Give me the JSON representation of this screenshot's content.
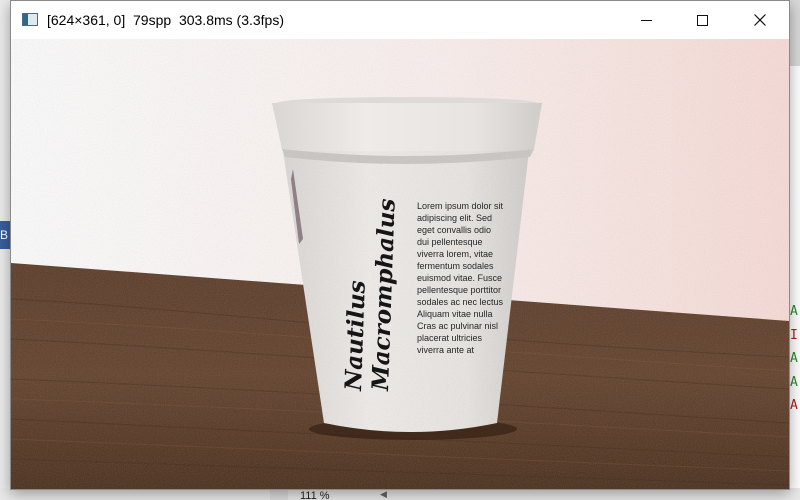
{
  "background": {
    "left_tab_text": "B",
    "right_letters": [
      {
        "char": "A",
        "color": "#2a8a2a"
      },
      {
        "char": "I",
        "color": "#b02020"
      },
      {
        "char": "A",
        "color": "#2a8a2a"
      },
      {
        "char": "A",
        "color": "#2a8a2a"
      },
      {
        "char": "A",
        "color": "#b02020"
      }
    ],
    "zoom_text": "111 %"
  },
  "window": {
    "title": "[624×361, 0]  79spp  303.8ms (3.3fps)",
    "minimize_icon": "minimize-icon",
    "maximize_icon": "maximize-icon",
    "close_icon": "close-icon"
  },
  "render": {
    "cup_title_line1": "Nautilus",
    "cup_title_line2": "Macromphalus",
    "cup_body_lines": [
      "Lorem ipsum dolor sit",
      "adipiscing elit. Sed",
      "eget convallis odio",
      "dui pellentesque",
      "viverra lorem, vitae",
      "fermentum sodales",
      "euismod vitae. Fusce",
      "pellentesque porttitor",
      "sodales ac nec lectus",
      "Aliquam vitae nulla",
      "Cras ac pulvinar nisl",
      "placerat ultricies",
      "viverra ante at"
    ],
    "colors": {
      "wall": "#f7e9e6",
      "table": "#5a3620",
      "cup": "#ece9e6"
    }
  }
}
